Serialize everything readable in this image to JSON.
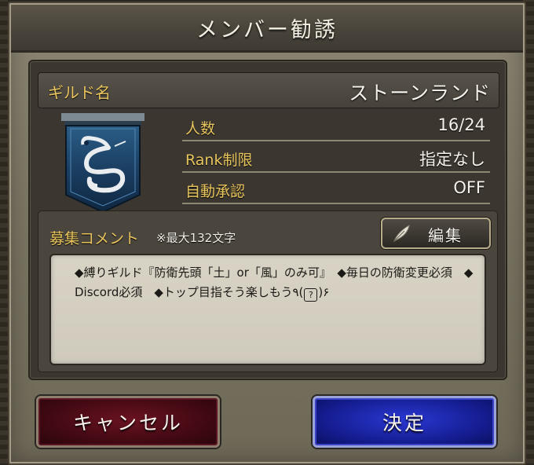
{
  "dialog": {
    "title": "メンバー勧誘"
  },
  "guild": {
    "name_label": "ギルド名",
    "name_value": "ストーンランド",
    "emblem_icon": "serpent-banner-icon",
    "stats": {
      "members_label": "人数",
      "members_value": "16/24",
      "rank_label": "Rank制限",
      "rank_value": "指定なし",
      "auto_label": "自動承認",
      "auto_value": "OFF"
    }
  },
  "comment": {
    "label": "募集コメント",
    "max_note": "※最大132文字",
    "edit_label": "編集",
    "edit_icon": "feather-quill-icon",
    "text_part1": "◆縛りギルド『防衛先頭「土」or「風」のみ可』　◆毎日の防衛変更必須　◆Discord必須　◆トップ目指そう楽しもう٩(",
    "badge": "?",
    "text_part2": ")۶"
  },
  "buttons": {
    "cancel_label": "キャンセル",
    "confirm_label": "決定"
  },
  "colors": {
    "label_gold": "#e9c55e",
    "cancel_red": "#4a0a15",
    "confirm_blue": "#1a24a8",
    "panel_dark": "#3b3730"
  }
}
